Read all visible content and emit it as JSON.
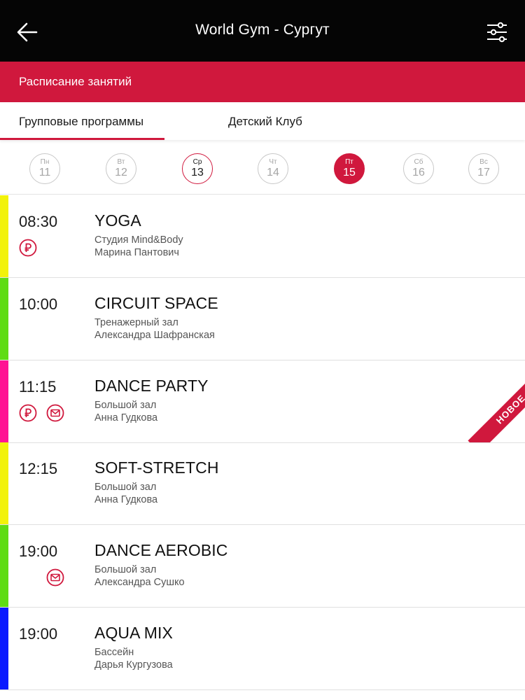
{
  "header": {
    "title": "World Gym - Сургут",
    "back_icon": "arrow-left-icon",
    "filter_icon": "sliders-icon"
  },
  "section": {
    "title": "Расписание занятий"
  },
  "tabs": [
    {
      "label": "Групповые программы",
      "active": true
    },
    {
      "label": "Детский Клуб",
      "active": false
    }
  ],
  "days": [
    {
      "weekday": "Пн",
      "date": "11"
    },
    {
      "weekday": "Вт",
      "date": "12"
    },
    {
      "weekday": "Ср",
      "date": "13",
      "today": true
    },
    {
      "weekday": "Чт",
      "date": "14"
    },
    {
      "weekday": "Пт",
      "date": "15",
      "selected": true
    },
    {
      "weekday": "Сб",
      "date": "16"
    },
    {
      "weekday": "Вс",
      "date": "17"
    }
  ],
  "classes": [
    {
      "time": "08:30",
      "name": "YOGA",
      "place": "Студия Mind&Body",
      "trainer": "Марина Пантович",
      "color": "#f2f20a",
      "icons": [
        "ruble-icon"
      ]
    },
    {
      "time": "10:00",
      "name": "CIRCUIT SPACE",
      "place": "Тренажерный зал",
      "trainer": "Александра Шафранская",
      "color": "#5fdc14",
      "icons": []
    },
    {
      "time": "11:15",
      "name": "DANCE PARTY",
      "place": "Большой зал",
      "trainer": "Анна Гудкова",
      "color": "#ff1493",
      "icons": [
        "ruble-icon",
        "mail-icon"
      ],
      "badge": "НОВОЕ"
    },
    {
      "time": "12:15",
      "name": "SOFT-STRETCH",
      "place": "Большой зал",
      "trainer": "Анна Гудкова",
      "color": "#f2f20a",
      "icons": []
    },
    {
      "time": "19:00",
      "name": "DANCE AEROBIC",
      "place": "Большой зал",
      "trainer": "Александра Сушко",
      "color": "#5fdc14",
      "icons": [
        "mail-icon"
      ]
    },
    {
      "time": "19:00",
      "name": "AQUA MIX",
      "place": "Бассейн",
      "trainer": "Дарья Кургузова",
      "color": "#0a1aff",
      "icons": []
    }
  ],
  "colors": {
    "accent": "#d0183d",
    "topbar": "#050505"
  }
}
